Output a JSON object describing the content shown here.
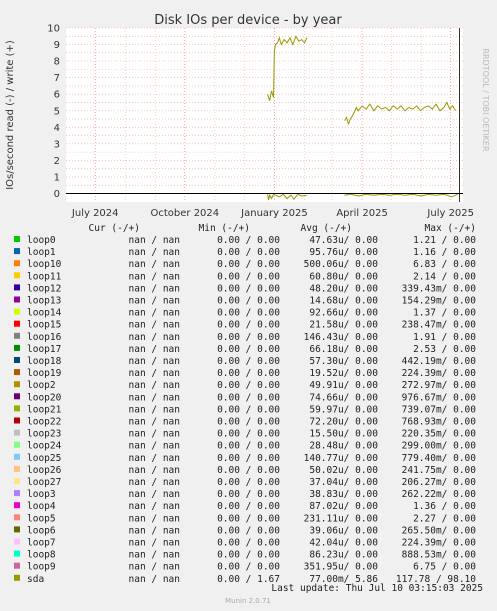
{
  "chart_data": {
    "type": "line",
    "title": "Disk IOs per device - by year",
    "ylabel": "IOs/second read (-) / write (+)",
    "ylim": [
      -0.5,
      10
    ],
    "yticks": [
      0,
      1,
      2,
      3,
      4,
      5,
      6,
      7,
      8,
      9,
      10
    ],
    "xticks": [
      "July 2024",
      "October 2024",
      "January 2025",
      "April 2025",
      "July 2025"
    ],
    "side_label": "RRDTOOL / TOBI OETIKER",
    "series_color": "#999900",
    "series": [
      {
        "name": "sda",
        "write_segments": [
          [
            [
              "2024-12-25",
              6.0
            ],
            [
              "2024-12-27",
              5.6
            ],
            [
              "2024-12-29",
              6.2
            ],
            [
              "2024-12-31",
              5.8
            ],
            [
              "2025-01-01",
              8.6
            ],
            [
              "2025-01-02",
              9.0
            ],
            [
              "2025-01-04",
              9.1
            ],
            [
              "2025-01-06",
              9.4
            ],
            [
              "2025-01-08",
              9.0
            ],
            [
              "2025-01-11",
              9.3
            ],
            [
              "2025-01-14",
              9.1
            ],
            [
              "2025-01-17",
              9.4
            ],
            [
              "2025-01-20",
              9.0
            ],
            [
              "2025-01-23",
              9.5
            ],
            [
              "2025-01-26",
              9.2
            ],
            [
              "2025-01-29",
              9.3
            ],
            [
              "2025-02-01",
              9.1
            ],
            [
              "2025-02-03",
              9.4
            ]
          ],
          [
            [
              "2025-03-14",
              4.4
            ],
            [
              "2025-03-16",
              4.6
            ],
            [
              "2025-03-18",
              4.2
            ],
            [
              "2025-03-20",
              4.5
            ],
            [
              "2025-03-22",
              4.7
            ],
            [
              "2025-03-24",
              4.9
            ],
            [
              "2025-03-26",
              5.2
            ],
            [
              "2025-03-28",
              5.0
            ],
            [
              "2025-04-01",
              5.3
            ],
            [
              "2025-04-05",
              5.1
            ],
            [
              "2025-04-09",
              5.4
            ],
            [
              "2025-04-13",
              5.0
            ],
            [
              "2025-04-17",
              5.3
            ],
            [
              "2025-04-21",
              5.1
            ],
            [
              "2025-04-25",
              5.2
            ],
            [
              "2025-04-29",
              5.0
            ],
            [
              "2025-05-03",
              5.3
            ],
            [
              "2025-05-07",
              5.1
            ],
            [
              "2025-05-11",
              5.3
            ],
            [
              "2025-05-15",
              5.0
            ],
            [
              "2025-05-19",
              5.2
            ],
            [
              "2025-05-23",
              5.1
            ],
            [
              "2025-05-27",
              5.3
            ],
            [
              "2025-05-31",
              5.0
            ],
            [
              "2025-06-04",
              5.2
            ],
            [
              "2025-06-08",
              5.3
            ],
            [
              "2025-06-12",
              5.1
            ],
            [
              "2025-06-16",
              5.4
            ],
            [
              "2025-06-20",
              5.0
            ],
            [
              "2025-06-24",
              5.2
            ],
            [
              "2025-06-27",
              5.5
            ],
            [
              "2025-06-30",
              5.1
            ],
            [
              "2025-07-03",
              5.3
            ],
            [
              "2025-07-06",
              5.0
            ]
          ]
        ],
        "read_segments": [
          [
            [
              "2024-12-25",
              -0.05
            ],
            [
              "2024-12-26",
              -0.4
            ],
            [
              "2024-12-27",
              -0.1
            ],
            [
              "2024-12-29",
              -0.3
            ],
            [
              "2024-12-31",
              -0.05
            ],
            [
              "2025-01-02",
              -0.1
            ],
            [
              "2025-01-06",
              -0.2
            ],
            [
              "2025-01-10",
              -0.05
            ],
            [
              "2025-01-14",
              -0.3
            ],
            [
              "2025-01-18",
              -0.1
            ],
            [
              "2025-01-21",
              -0.35
            ],
            [
              "2025-01-25",
              -0.05
            ],
            [
              "2025-01-29",
              -0.15
            ],
            [
              "2025-02-03",
              -0.1
            ]
          ],
          [
            [
              "2025-03-14",
              -0.1
            ],
            [
              "2025-03-20",
              -0.05
            ],
            [
              "2025-03-28",
              -0.15
            ],
            [
              "2025-04-05",
              -0.05
            ],
            [
              "2025-04-13",
              -0.1
            ],
            [
              "2025-04-21",
              -0.05
            ],
            [
              "2025-04-29",
              -0.1
            ],
            [
              "2025-05-07",
              -0.05
            ],
            [
              "2025-05-15",
              -0.1
            ],
            [
              "2025-05-23",
              -0.05
            ],
            [
              "2025-05-31",
              -0.15
            ],
            [
              "2025-06-08",
              -0.05
            ],
            [
              "2025-06-16",
              -0.1
            ],
            [
              "2025-06-24",
              -0.05
            ],
            [
              "2025-07-02",
              -0.2
            ],
            [
              "2025-07-08",
              -0.05
            ]
          ]
        ]
      }
    ]
  },
  "legend": {
    "headers": [
      "Cur (-/+)",
      "Min (-/+)",
      "Avg (-/+)",
      "Max (-/+)"
    ],
    "rows": [
      {
        "name": "loop0",
        "color": "#00cc00",
        "cur": "nan /   nan",
        "min": "0.00 /  0.00",
        "avg": "47.63u/  0.00",
        "max": "1.21 /  0.00"
      },
      {
        "name": "loop1",
        "color": "#0066b3",
        "cur": "nan /   nan",
        "min": "0.00 /  0.00",
        "avg": "95.76u/  0.00",
        "max": "1.16 /  0.00"
      },
      {
        "name": "loop10",
        "color": "#ff8000",
        "cur": "nan /   nan",
        "min": "0.00 /  0.00",
        "avg": "500.06u/  0.00",
        "max": "6.83 /  0.00"
      },
      {
        "name": "loop11",
        "color": "#ffcc00",
        "cur": "nan /   nan",
        "min": "0.00 /  0.00",
        "avg": "60.80u/  0.00",
        "max": "2.14 /  0.00"
      },
      {
        "name": "loop12",
        "color": "#330099",
        "cur": "nan /   nan",
        "min": "0.00 /  0.00",
        "avg": "48.20u/  0.00",
        "max": "339.43m/  0.00"
      },
      {
        "name": "loop13",
        "color": "#990099",
        "cur": "nan /   nan",
        "min": "0.00 /  0.00",
        "avg": "14.68u/  0.00",
        "max": "154.29m/  0.00"
      },
      {
        "name": "loop14",
        "color": "#ccff00",
        "cur": "nan /   nan",
        "min": "0.00 /  0.00",
        "avg": "92.66u/  0.00",
        "max": "1.37 /  0.00"
      },
      {
        "name": "loop15",
        "color": "#ff0000",
        "cur": "nan /   nan",
        "min": "0.00 /  0.00",
        "avg": "21.58u/  0.00",
        "max": "238.47m/  0.00"
      },
      {
        "name": "loop16",
        "color": "#808080",
        "cur": "nan /   nan",
        "min": "0.00 /  0.00",
        "avg": "146.43u/  0.00",
        "max": "1.91 /  0.00"
      },
      {
        "name": "loop17",
        "color": "#008f00",
        "cur": "nan /   nan",
        "min": "0.00 /  0.00",
        "avg": "66.18u/  0.00",
        "max": "2.53 /  0.00"
      },
      {
        "name": "loop18",
        "color": "#00487d",
        "cur": "nan /   nan",
        "min": "0.00 /  0.00",
        "avg": "57.30u/  0.00",
        "max": "442.19m/  0.00"
      },
      {
        "name": "loop19",
        "color": "#b35a00",
        "cur": "nan /   nan",
        "min": "0.00 /  0.00",
        "avg": "19.52u/  0.00",
        "max": "224.39m/  0.00"
      },
      {
        "name": "loop2",
        "color": "#b38f00",
        "cur": "nan /   nan",
        "min": "0.00 /  0.00",
        "avg": "49.91u/  0.00",
        "max": "272.97m/  0.00"
      },
      {
        "name": "loop20",
        "color": "#6b006b",
        "cur": "nan /   nan",
        "min": "0.00 /  0.00",
        "avg": "74.66u/  0.00",
        "max": "976.67m/  0.00"
      },
      {
        "name": "loop21",
        "color": "#8fb300",
        "cur": "nan /   nan",
        "min": "0.00 /  0.00",
        "avg": "59.97u/  0.00",
        "max": "739.07m/  0.00"
      },
      {
        "name": "loop22",
        "color": "#b30000",
        "cur": "nan /   nan",
        "min": "0.00 /  0.00",
        "avg": "72.20u/  0.00",
        "max": "768.93m/  0.00"
      },
      {
        "name": "loop23",
        "color": "#bebebe",
        "cur": "nan /   nan",
        "min": "0.00 /  0.00",
        "avg": "15.50u/  0.00",
        "max": "220.35m/  0.00"
      },
      {
        "name": "loop24",
        "color": "#80ff80",
        "cur": "nan /   nan",
        "min": "0.00 /  0.00",
        "avg": "28.48u/  0.00",
        "max": "299.00m/  0.00"
      },
      {
        "name": "loop25",
        "color": "#80c9ff",
        "cur": "nan /   nan",
        "min": "0.00 /  0.00",
        "avg": "140.77u/  0.00",
        "max": "779.40m/  0.00"
      },
      {
        "name": "loop26",
        "color": "#ffc080",
        "cur": "nan /   nan",
        "min": "0.00 /  0.00",
        "avg": "50.02u/  0.00",
        "max": "241.75m/  0.00"
      },
      {
        "name": "loop27",
        "color": "#ffe680",
        "cur": "nan /   nan",
        "min": "0.00 /  0.00",
        "avg": "37.04u/  0.00",
        "max": "206.27m/  0.00"
      },
      {
        "name": "loop3",
        "color": "#aa80ff",
        "cur": "nan /   nan",
        "min": "0.00 /  0.00",
        "avg": "38.83u/  0.00",
        "max": "262.22m/  0.00"
      },
      {
        "name": "loop4",
        "color": "#ee00cc",
        "cur": "nan /   nan",
        "min": "0.00 /  0.00",
        "avg": "87.02u/  0.00",
        "max": "1.36 /  0.00"
      },
      {
        "name": "loop5",
        "color": "#ff8080",
        "cur": "nan /   nan",
        "min": "0.00 /  0.00",
        "avg": "231.11u/  0.00",
        "max": "2.27 /  0.00"
      },
      {
        "name": "loop6",
        "color": "#666600",
        "cur": "nan /   nan",
        "min": "0.00 /  0.00",
        "avg": "39.06u/  0.00",
        "max": "265.50m/  0.00"
      },
      {
        "name": "loop7",
        "color": "#ffbfff",
        "cur": "nan /   nan",
        "min": "0.00 /  0.00",
        "avg": "42.04u/  0.00",
        "max": "224.39m/  0.00"
      },
      {
        "name": "loop8",
        "color": "#00ffcc",
        "cur": "nan /   nan",
        "min": "0.00 /  0.00",
        "avg": "86.23u/  0.00",
        "max": "888.53m/  0.00"
      },
      {
        "name": "loop9",
        "color": "#cc6699",
        "cur": "nan /   nan",
        "min": "0.00 /  0.00",
        "avg": "351.95u/  0.00",
        "max": "6.75 /  0.00"
      },
      {
        "name": "sda",
        "color": "#999900",
        "cur": "nan /   nan",
        "min": "0.00 /  1.67",
        "avg": "77.00m/  5.86",
        "max": "117.78 / 98.10"
      }
    ]
  },
  "footer": {
    "last_update": "Last update: Thu Jul 10 03:15:03 2025",
    "version": "Munin 2.0.71"
  }
}
